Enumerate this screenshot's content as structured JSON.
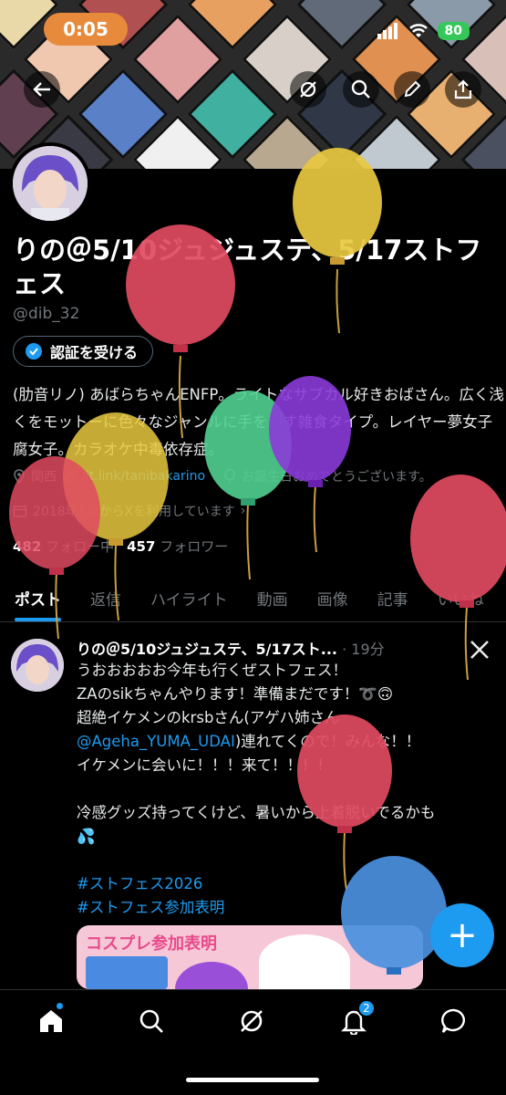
{
  "status_bar": {
    "time": "0:05",
    "battery": "80"
  },
  "header": {
    "back_icon": "back-arrow-icon",
    "grok_icon": "grok-icon",
    "search_icon": "search-icon",
    "edit_icon": "pencil-icon",
    "share_icon": "share-icon"
  },
  "profile": {
    "display_name": "りの＠5/10ジュジュステ、5/17ストフェス",
    "handle": "@dib_32",
    "verify_button": "認証を受ける",
    "bio": "(肋音リノ) あばらちゃんENFP。ライトなサブカル好きおばさん。広く浅くをモットーに色々なジャンルに手を出す雑食タイプ。レイヤー夢女子腐女子。カラオケ中毒依存症。",
    "location": "関西",
    "link": "lit.link/tanibakarino",
    "birthday": "お誕生日おめでとうございます。",
    "joined": "2018年1月からXを利用しています",
    "following_count": "482",
    "following_label": "フォロー中",
    "followers_count": "457",
    "followers_label": "フォロワー"
  },
  "tabs": [
    "ポスト",
    "返信",
    "ハイライト",
    "動画",
    "画像",
    "記事",
    "いいね"
  ],
  "post": {
    "author": "りの＠5/10ジュジュステ、5/17スト...",
    "time": "· 19分",
    "line1": "うおおおおお今年も行くぜストフェス！",
    "line2": "ZAのsikちゃんやります！準備まだです！➰🙃",
    "line3": "超絶イケメンのkrsbさん(アゲハ姉さん",
    "mention": "@Ageha_YUMA_UDAI",
    "line4": ")連れてくので！みんな！！",
    "line5": "イケメンに会いに！！！来て！！！！",
    "line6": "冷感グッズ持ってくけど、暑いから上着脱いでるかも",
    "line7": "💦",
    "hashtag1": "#ストフェス2026",
    "hashtag2": "#ストフェス参加表明",
    "image_text": "コスプレ参加表明"
  },
  "fab_label": "+",
  "bottom_nav": {
    "notifications_badge": "2"
  },
  "colors": {
    "accent": "#1d9bf0",
    "muted": "#71767b",
    "background": "#000000",
    "battery": "#35c759",
    "time_pill": "#e88a3c"
  }
}
